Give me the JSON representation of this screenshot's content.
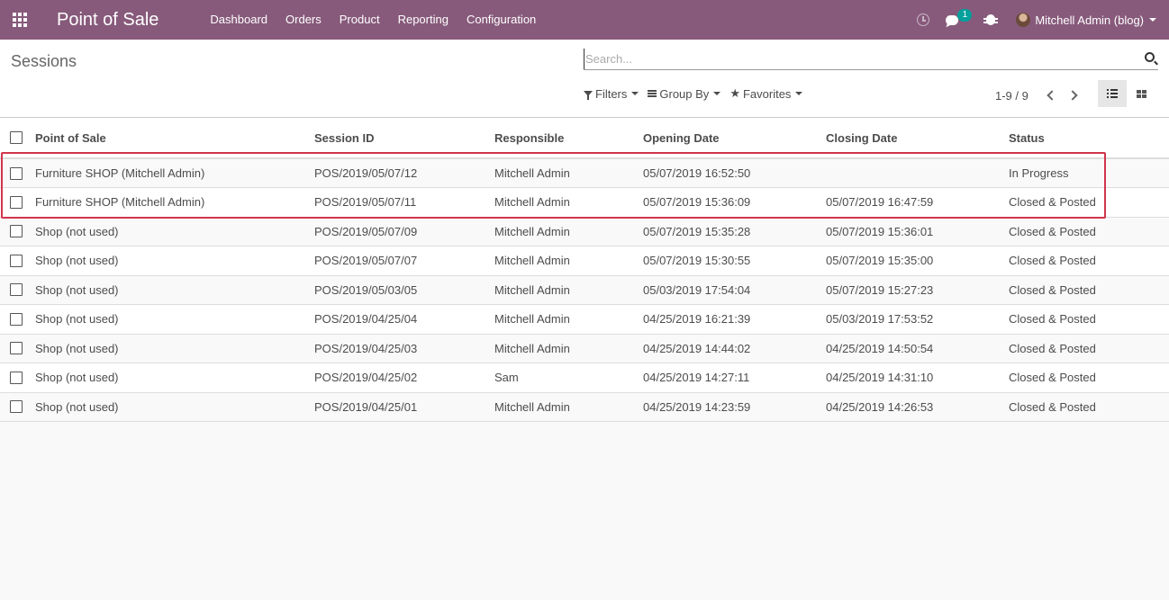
{
  "navbar": {
    "app_title": "Point of Sale",
    "menu": [
      "Dashboard",
      "Orders",
      "Product",
      "Reporting",
      "Configuration"
    ],
    "systray": {
      "activity_icon": "clock-icon",
      "messaging_icon": "chat-icon",
      "messaging_count": "1",
      "debug_icon": "bug-icon",
      "user_name": "Mitchell Admin (blog)"
    },
    "colors": {
      "brand": "#875a7b",
      "badge": "#00a09d"
    }
  },
  "control_panel": {
    "breadcrumb": "Sessions",
    "search": {
      "placeholder": "Search...",
      "value": ""
    },
    "filters_label": "Filters",
    "groupby_label": "Group By",
    "favorites_label": "Favorites",
    "pager": "1-9 / 9",
    "views": [
      "list",
      "kanban"
    ],
    "active_view": "list"
  },
  "table": {
    "columns": [
      "Point of Sale",
      "Session ID",
      "Responsible",
      "Opening Date",
      "Closing Date",
      "Status"
    ],
    "rows": [
      {
        "pos": "Furniture SHOP (Mitchell Admin)",
        "session_id": "POS/2019/05/07/12",
        "responsible": "Mitchell Admin",
        "opening": "05/07/2019 16:52:50",
        "closing": "",
        "status": "In Progress"
      },
      {
        "pos": "Furniture SHOP (Mitchell Admin)",
        "session_id": "POS/2019/05/07/11",
        "responsible": "Mitchell Admin",
        "opening": "05/07/2019 15:36:09",
        "closing": "05/07/2019 16:47:59",
        "status": "Closed & Posted"
      },
      {
        "pos": "Shop (not used)",
        "session_id": "POS/2019/05/07/09",
        "responsible": "Mitchell Admin",
        "opening": "05/07/2019 15:35:28",
        "closing": "05/07/2019 15:36:01",
        "status": "Closed & Posted"
      },
      {
        "pos": "Shop (not used)",
        "session_id": "POS/2019/05/07/07",
        "responsible": "Mitchell Admin",
        "opening": "05/07/2019 15:30:55",
        "closing": "05/07/2019 15:35:00",
        "status": "Closed & Posted"
      },
      {
        "pos": "Shop (not used)",
        "session_id": "POS/2019/05/03/05",
        "responsible": "Mitchell Admin",
        "opening": "05/03/2019 17:54:04",
        "closing": "05/07/2019 15:27:23",
        "status": "Closed & Posted"
      },
      {
        "pos": "Shop (not used)",
        "session_id": "POS/2019/04/25/04",
        "responsible": "Mitchell Admin",
        "opening": "04/25/2019 16:21:39",
        "closing": "05/03/2019 17:53:52",
        "status": "Closed & Posted"
      },
      {
        "pos": "Shop (not used)",
        "session_id": "POS/2019/04/25/03",
        "responsible": "Mitchell Admin",
        "opening": "04/25/2019 14:44:02",
        "closing": "04/25/2019 14:50:54",
        "status": "Closed & Posted"
      },
      {
        "pos": "Shop (not used)",
        "session_id": "POS/2019/04/25/02",
        "responsible": "Sam",
        "opening": "04/25/2019 14:27:11",
        "closing": "04/25/2019 14:31:10",
        "status": "Closed & Posted"
      },
      {
        "pos": "Shop (not used)",
        "session_id": "POS/2019/04/25/01",
        "responsible": "Mitchell Admin",
        "opening": "04/25/2019 14:23:59",
        "closing": "04/25/2019 14:26:53",
        "status": "Closed & Posted"
      }
    ],
    "highlight_color": "#d0354b"
  }
}
